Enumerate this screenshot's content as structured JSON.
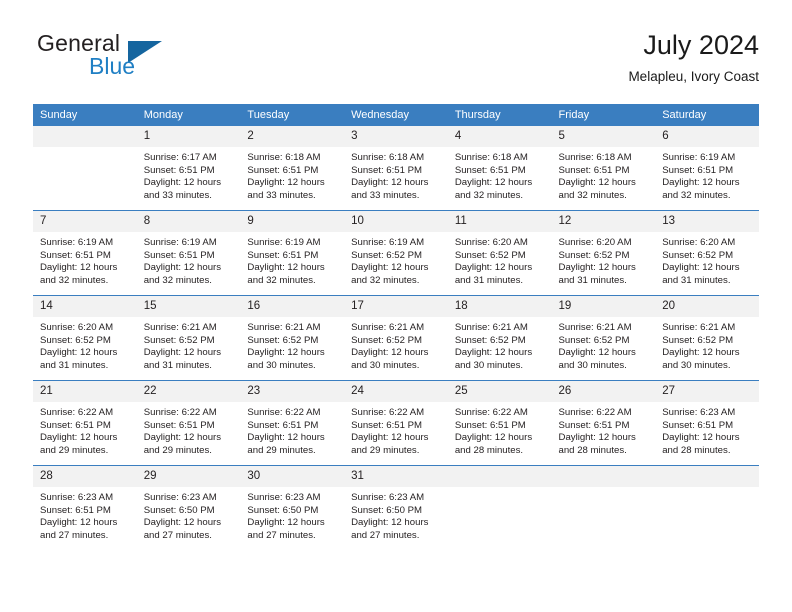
{
  "brand": {
    "name_part1": "General",
    "name_part2": "Blue",
    "accent_color": "#1f7fc4",
    "triangle_color": "#15659f"
  },
  "header": {
    "month_title": "July 2024",
    "location": "Melapleu, Ivory Coast",
    "header_background": "#3a7ec0"
  },
  "weekday_headers": [
    "Sunday",
    "Monday",
    "Tuesday",
    "Wednesday",
    "Thursday",
    "Friday",
    "Saturday"
  ],
  "weeks": [
    [
      {
        "day": "",
        "empty": true,
        "sunrise": "",
        "sunset": "",
        "daylight_line1": "",
        "daylight_line2": ""
      },
      {
        "day": "1",
        "sunrise": "Sunrise: 6:17 AM",
        "sunset": "Sunset: 6:51 PM",
        "daylight_line1": "Daylight: 12 hours",
        "daylight_line2": "and 33 minutes."
      },
      {
        "day": "2",
        "sunrise": "Sunrise: 6:18 AM",
        "sunset": "Sunset: 6:51 PM",
        "daylight_line1": "Daylight: 12 hours",
        "daylight_line2": "and 33 minutes."
      },
      {
        "day": "3",
        "sunrise": "Sunrise: 6:18 AM",
        "sunset": "Sunset: 6:51 PM",
        "daylight_line1": "Daylight: 12 hours",
        "daylight_line2": "and 33 minutes."
      },
      {
        "day": "4",
        "sunrise": "Sunrise: 6:18 AM",
        "sunset": "Sunset: 6:51 PM",
        "daylight_line1": "Daylight: 12 hours",
        "daylight_line2": "and 32 minutes."
      },
      {
        "day": "5",
        "sunrise": "Sunrise: 6:18 AM",
        "sunset": "Sunset: 6:51 PM",
        "daylight_line1": "Daylight: 12 hours",
        "daylight_line2": "and 32 minutes."
      },
      {
        "day": "6",
        "sunrise": "Sunrise: 6:19 AM",
        "sunset": "Sunset: 6:51 PM",
        "daylight_line1": "Daylight: 12 hours",
        "daylight_line2": "and 32 minutes."
      }
    ],
    [
      {
        "day": "7",
        "sunrise": "Sunrise: 6:19 AM",
        "sunset": "Sunset: 6:51 PM",
        "daylight_line1": "Daylight: 12 hours",
        "daylight_line2": "and 32 minutes."
      },
      {
        "day": "8",
        "sunrise": "Sunrise: 6:19 AM",
        "sunset": "Sunset: 6:51 PM",
        "daylight_line1": "Daylight: 12 hours",
        "daylight_line2": "and 32 minutes."
      },
      {
        "day": "9",
        "sunrise": "Sunrise: 6:19 AM",
        "sunset": "Sunset: 6:51 PM",
        "daylight_line1": "Daylight: 12 hours",
        "daylight_line2": "and 32 minutes."
      },
      {
        "day": "10",
        "sunrise": "Sunrise: 6:19 AM",
        "sunset": "Sunset: 6:52 PM",
        "daylight_line1": "Daylight: 12 hours",
        "daylight_line2": "and 32 minutes."
      },
      {
        "day": "11",
        "sunrise": "Sunrise: 6:20 AM",
        "sunset": "Sunset: 6:52 PM",
        "daylight_line1": "Daylight: 12 hours",
        "daylight_line2": "and 31 minutes."
      },
      {
        "day": "12",
        "sunrise": "Sunrise: 6:20 AM",
        "sunset": "Sunset: 6:52 PM",
        "daylight_line1": "Daylight: 12 hours",
        "daylight_line2": "and 31 minutes."
      },
      {
        "day": "13",
        "sunrise": "Sunrise: 6:20 AM",
        "sunset": "Sunset: 6:52 PM",
        "daylight_line1": "Daylight: 12 hours",
        "daylight_line2": "and 31 minutes."
      }
    ],
    [
      {
        "day": "14",
        "sunrise": "Sunrise: 6:20 AM",
        "sunset": "Sunset: 6:52 PM",
        "daylight_line1": "Daylight: 12 hours",
        "daylight_line2": "and 31 minutes."
      },
      {
        "day": "15",
        "sunrise": "Sunrise: 6:21 AM",
        "sunset": "Sunset: 6:52 PM",
        "daylight_line1": "Daylight: 12 hours",
        "daylight_line2": "and 31 minutes."
      },
      {
        "day": "16",
        "sunrise": "Sunrise: 6:21 AM",
        "sunset": "Sunset: 6:52 PM",
        "daylight_line1": "Daylight: 12 hours",
        "daylight_line2": "and 30 minutes."
      },
      {
        "day": "17",
        "sunrise": "Sunrise: 6:21 AM",
        "sunset": "Sunset: 6:52 PM",
        "daylight_line1": "Daylight: 12 hours",
        "daylight_line2": "and 30 minutes."
      },
      {
        "day": "18",
        "sunrise": "Sunrise: 6:21 AM",
        "sunset": "Sunset: 6:52 PM",
        "daylight_line1": "Daylight: 12 hours",
        "daylight_line2": "and 30 minutes."
      },
      {
        "day": "19",
        "sunrise": "Sunrise: 6:21 AM",
        "sunset": "Sunset: 6:52 PM",
        "daylight_line1": "Daylight: 12 hours",
        "daylight_line2": "and 30 minutes."
      },
      {
        "day": "20",
        "sunrise": "Sunrise: 6:21 AM",
        "sunset": "Sunset: 6:52 PM",
        "daylight_line1": "Daylight: 12 hours",
        "daylight_line2": "and 30 minutes."
      }
    ],
    [
      {
        "day": "21",
        "sunrise": "Sunrise: 6:22 AM",
        "sunset": "Sunset: 6:51 PM",
        "daylight_line1": "Daylight: 12 hours",
        "daylight_line2": "and 29 minutes."
      },
      {
        "day": "22",
        "sunrise": "Sunrise: 6:22 AM",
        "sunset": "Sunset: 6:51 PM",
        "daylight_line1": "Daylight: 12 hours",
        "daylight_line2": "and 29 minutes."
      },
      {
        "day": "23",
        "sunrise": "Sunrise: 6:22 AM",
        "sunset": "Sunset: 6:51 PM",
        "daylight_line1": "Daylight: 12 hours",
        "daylight_line2": "and 29 minutes."
      },
      {
        "day": "24",
        "sunrise": "Sunrise: 6:22 AM",
        "sunset": "Sunset: 6:51 PM",
        "daylight_line1": "Daylight: 12 hours",
        "daylight_line2": "and 29 minutes."
      },
      {
        "day": "25",
        "sunrise": "Sunrise: 6:22 AM",
        "sunset": "Sunset: 6:51 PM",
        "daylight_line1": "Daylight: 12 hours",
        "daylight_line2": "and 28 minutes."
      },
      {
        "day": "26",
        "sunrise": "Sunrise: 6:22 AM",
        "sunset": "Sunset: 6:51 PM",
        "daylight_line1": "Daylight: 12 hours",
        "daylight_line2": "and 28 minutes."
      },
      {
        "day": "27",
        "sunrise": "Sunrise: 6:23 AM",
        "sunset": "Sunset: 6:51 PM",
        "daylight_line1": "Daylight: 12 hours",
        "daylight_line2": "and 28 minutes."
      }
    ],
    [
      {
        "day": "28",
        "sunrise": "Sunrise: 6:23 AM",
        "sunset": "Sunset: 6:51 PM",
        "daylight_line1": "Daylight: 12 hours",
        "daylight_line2": "and 27 minutes."
      },
      {
        "day": "29",
        "sunrise": "Sunrise: 6:23 AM",
        "sunset": "Sunset: 6:50 PM",
        "daylight_line1": "Daylight: 12 hours",
        "daylight_line2": "and 27 minutes."
      },
      {
        "day": "30",
        "sunrise": "Sunrise: 6:23 AM",
        "sunset": "Sunset: 6:50 PM",
        "daylight_line1": "Daylight: 12 hours",
        "daylight_line2": "and 27 minutes."
      },
      {
        "day": "31",
        "sunrise": "Sunrise: 6:23 AM",
        "sunset": "Sunset: 6:50 PM",
        "daylight_line1": "Daylight: 12 hours",
        "daylight_line2": "and 27 minutes."
      },
      {
        "day": "",
        "empty": true,
        "sunrise": "",
        "sunset": "",
        "daylight_line1": "",
        "daylight_line2": ""
      },
      {
        "day": "",
        "empty": true,
        "sunrise": "",
        "sunset": "",
        "daylight_line1": "",
        "daylight_line2": ""
      },
      {
        "day": "",
        "empty": true,
        "sunrise": "",
        "sunset": "",
        "daylight_line1": "",
        "daylight_line2": ""
      }
    ]
  ]
}
